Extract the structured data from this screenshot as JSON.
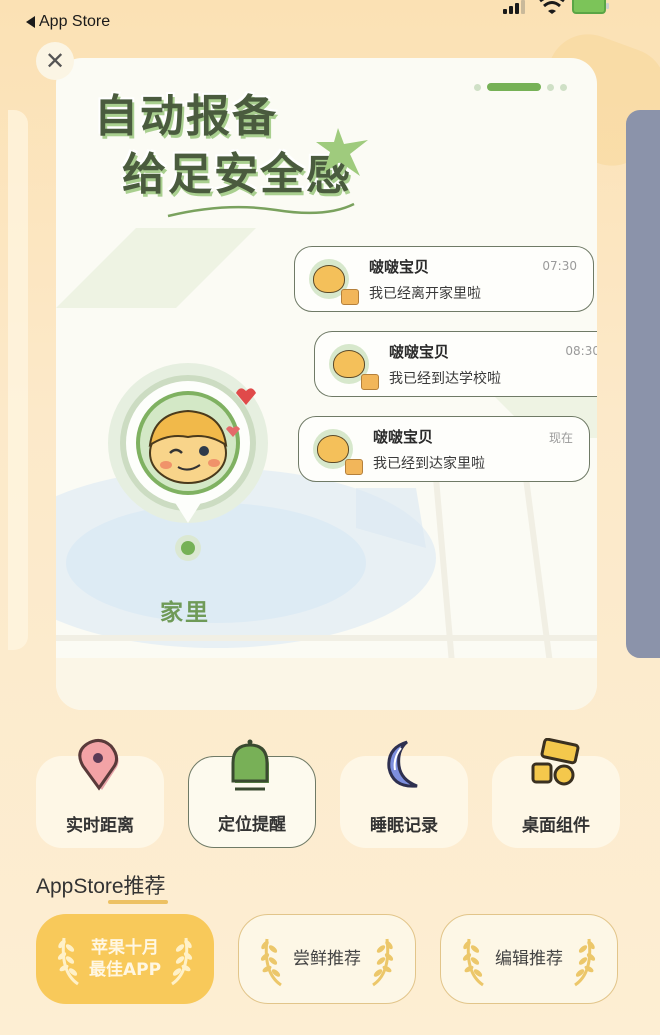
{
  "status_bar": {
    "back_label": "App Store",
    "signal_icon": "cellular-signal-icon",
    "wifi_icon": "wifi-icon",
    "battery_icon": "battery-charging-icon"
  },
  "close_icon": "close-icon",
  "banner": {
    "title_line1": "自动报备",
    "title_line2": "给足安全感",
    "carousel": {
      "total": 4,
      "active_index": 1
    },
    "location": {
      "label": "家里"
    },
    "messages": [
      {
        "name": "啵啵宝贝",
        "text": "我已经离开家里啦",
        "time": "07:30"
      },
      {
        "name": "啵啵宝贝",
        "text": "我已经到达学校啦",
        "time": "08:30"
      },
      {
        "name": "啵啵宝贝",
        "text": "我已经到达家里啦",
        "time": "现在"
      }
    ]
  },
  "features": [
    {
      "label": "实时距离",
      "icon": "location-pin-icon"
    },
    {
      "label": "定位提醒",
      "icon": "bell-icon"
    },
    {
      "label": "睡眠记录",
      "icon": "moon-icon"
    },
    {
      "label": "桌面组件",
      "icon": "widgets-icon"
    }
  ],
  "recommendations": {
    "title": "AppStore推荐",
    "items": [
      {
        "label_line1": "苹果十月",
        "label_line2": "最佳APP"
      },
      {
        "label_line1": "尝鲜推荐",
        "label_line2": ""
      },
      {
        "label_line1": "编辑推荐",
        "label_line2": ""
      }
    ]
  },
  "colors": {
    "accent_green": "#76b156",
    "gold": "#f8c95a",
    "background": "#fbe7c2"
  }
}
